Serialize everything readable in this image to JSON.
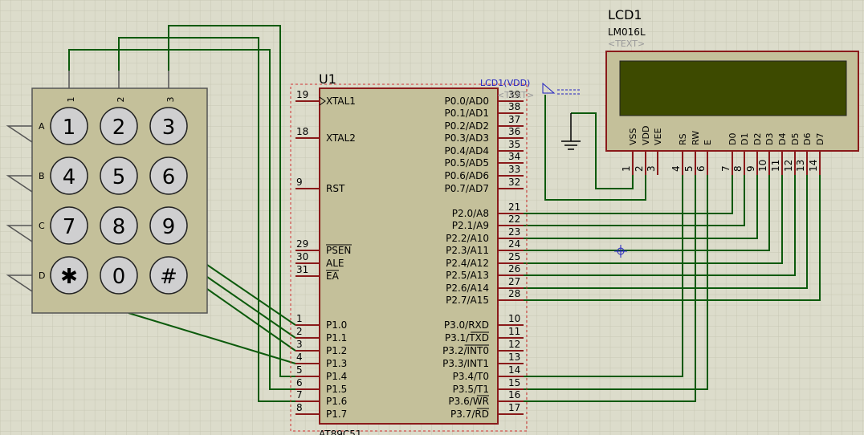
{
  "mcu": {
    "ref": "U1",
    "part": "AT89C51",
    "left_pins": [
      {
        "num": "19",
        "name": "XTAL1",
        "clock": true
      },
      {
        "num": "18",
        "name": "XTAL2"
      },
      {
        "num": "9",
        "name": "RST"
      },
      {
        "num": "29",
        "name": "PSEN",
        "overline": true
      },
      {
        "num": "30",
        "name": "ALE"
      },
      {
        "num": "31",
        "name": "EA",
        "overline": true
      },
      {
        "num": "1",
        "name": "P1.0"
      },
      {
        "num": "2",
        "name": "P1.1"
      },
      {
        "num": "3",
        "name": "P1.2"
      },
      {
        "num": "4",
        "name": "P1.3"
      },
      {
        "num": "5",
        "name": "P1.4"
      },
      {
        "num": "6",
        "name": "P1.5"
      },
      {
        "num": "7",
        "name": "P1.6"
      },
      {
        "num": "8",
        "name": "P1.7"
      }
    ],
    "right_pins": [
      {
        "num": "39",
        "name": "P0.0/AD0"
      },
      {
        "num": "38",
        "name": "P0.1/AD1"
      },
      {
        "num": "37",
        "name": "P0.2/AD2"
      },
      {
        "num": "36",
        "name": "P0.3/AD3"
      },
      {
        "num": "35",
        "name": "P0.4/AD4"
      },
      {
        "num": "34",
        "name": "P0.5/AD5"
      },
      {
        "num": "33",
        "name": "P0.6/AD6"
      },
      {
        "num": "32",
        "name": "P0.7/AD7"
      },
      {
        "num": "21",
        "name": "P2.0/A8"
      },
      {
        "num": "22",
        "name": "P2.1/A9"
      },
      {
        "num": "23",
        "name": "P2.2/A10"
      },
      {
        "num": "24",
        "name": "P2.3/A11"
      },
      {
        "num": "25",
        "name": "P2.4/A12"
      },
      {
        "num": "26",
        "name": "P2.5/A13"
      },
      {
        "num": "27",
        "name": "P2.6/A14"
      },
      {
        "num": "28",
        "name": "P2.7/A15"
      },
      {
        "num": "10",
        "name": "P3.0/RXD"
      },
      {
        "num": "11",
        "name": "P3.1/TXD",
        "ol": "TXD"
      },
      {
        "num": "12",
        "name": "P3.2/INT0",
        "ol": "INT0"
      },
      {
        "num": "13",
        "name": "P3.3/INT1"
      },
      {
        "num": "14",
        "name": "P3.4/T0"
      },
      {
        "num": "15",
        "name": "P3.5/T1"
      },
      {
        "num": "16",
        "name": "P3.6/WR",
        "ol": "WR"
      },
      {
        "num": "17",
        "name": "P3.7/RD",
        "ol": "RD"
      }
    ]
  },
  "lcd": {
    "ref": "LCD1",
    "part": "LM016L",
    "text_placeholder": "<TEXT>",
    "screen_color": "#3d4a00",
    "pins": [
      {
        "num": "1",
        "name": "VSS"
      },
      {
        "num": "2",
        "name": "VDD"
      },
      {
        "num": "3",
        "name": "VEE"
      },
      {
        "num": "4",
        "name": "RS"
      },
      {
        "num": "5",
        "name": "RW"
      },
      {
        "num": "6",
        "name": "E"
      },
      {
        "num": "7",
        "name": "D0"
      },
      {
        "num": "8",
        "name": "D1"
      },
      {
        "num": "9",
        "name": "D2"
      },
      {
        "num": "10",
        "name": "D3"
      },
      {
        "num": "11",
        "name": "D4"
      },
      {
        "num": "12",
        "name": "D5"
      },
      {
        "num": "13",
        "name": "D6"
      },
      {
        "num": "14",
        "name": "D7"
      }
    ]
  },
  "power": {
    "label": "LCD1(VDD)",
    "text_placeholder": "<TEXT>"
  },
  "keypad": {
    "columns": [
      "1",
      "2",
      "3"
    ],
    "rows": [
      "A",
      "B",
      "C",
      "D"
    ],
    "keys": [
      [
        "1",
        "2",
        "3"
      ],
      [
        "4",
        "5",
        "6"
      ],
      [
        "7",
        "8",
        "9"
      ],
      [
        "✱",
        "0",
        "#"
      ]
    ]
  },
  "colors": {
    "wire": "#0c5a0c",
    "pin": "#8a1a1a",
    "body": "#c4c09a",
    "background": "#dcdccb",
    "power_label": "#2020c0"
  }
}
